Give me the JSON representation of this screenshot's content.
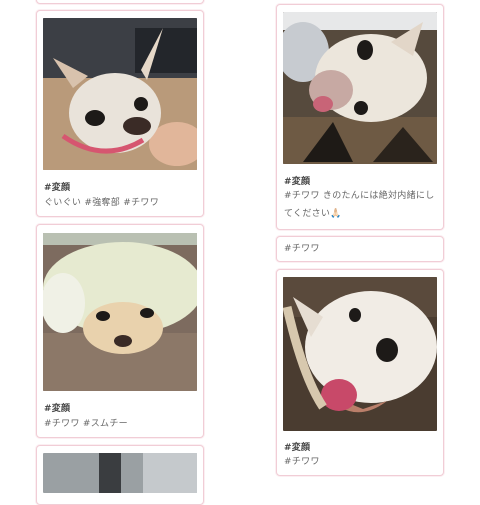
{
  "feed": {
    "left": [
      {
        "id": "l-top",
        "tag_title": "",
        "tags": ""
      },
      {
        "id": "l1",
        "tag_title": "#変顔",
        "tags": "ぐいぐい #強奪部 #チワワ"
      },
      {
        "id": "l2",
        "tag_title": "#変顔",
        "tags": "#チワワ #スムチー"
      },
      {
        "id": "l3",
        "tag_title": "",
        "tags": ""
      }
    ],
    "right": [
      {
        "id": "r1",
        "tag_title": "#変顔",
        "tags": "#チワワ きのたんには絶対内緒にしてください🙏🏻"
      },
      {
        "id": "r2",
        "tag_title": "",
        "tags": "#チワワ"
      },
      {
        "id": "r3",
        "tag_title": "#変顔",
        "tags": "#チワワ"
      }
    ]
  },
  "colors": {
    "card_border": "#f1cdd6",
    "background": "#ffffff"
  }
}
